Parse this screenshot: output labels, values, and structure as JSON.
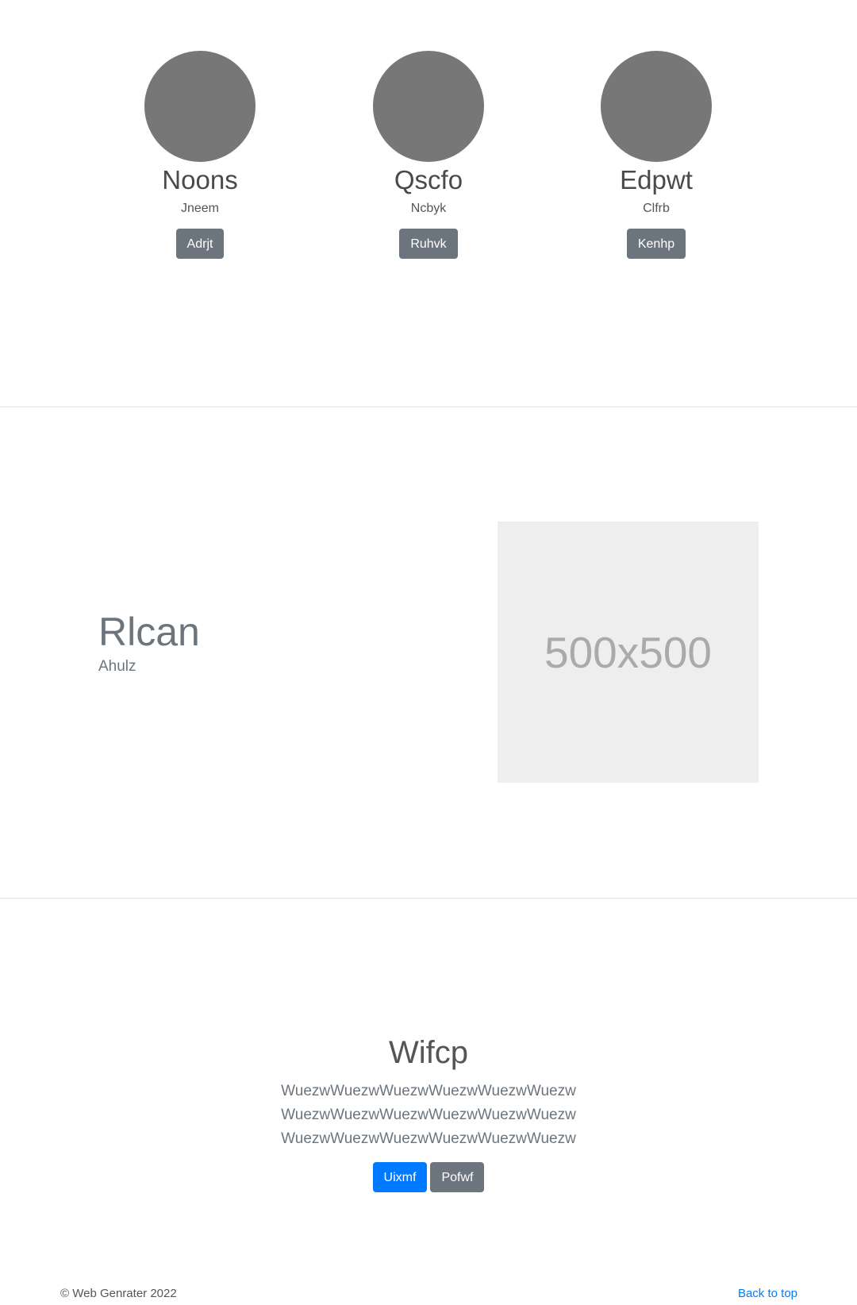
{
  "team": {
    "members": [
      {
        "name": "Noons",
        "role": "Jneem",
        "button_label": "Adrjt"
      },
      {
        "name": "Qscfo",
        "role": "Ncbyk",
        "button_label": "Ruhvk"
      },
      {
        "name": "Edpwt",
        "role": "Clfrb",
        "button_label": "Kenhp"
      }
    ]
  },
  "feature": {
    "title": "Rlcan",
    "subtitle": "Ahulz",
    "image_placeholder": "500x500"
  },
  "hero": {
    "title": "Wifcp",
    "lead": "WuezwWuezwWuezwWuezwWuezwWuezwWuezwWuezwWuezwWuezwWuezwWuezwWuezwWuezwWuezwWuezwWuezwWuezw",
    "primary_button": "Uixmf",
    "secondary_button": "Pofwf"
  },
  "footer": {
    "copyright": "© Web Genrater 2022",
    "back_to_top": "Back to top"
  },
  "colors": {
    "avatar": "#777777",
    "secondary_button": "#6c757d",
    "primary_button": "#007bff",
    "placeholder_bg": "#eeeeee"
  }
}
